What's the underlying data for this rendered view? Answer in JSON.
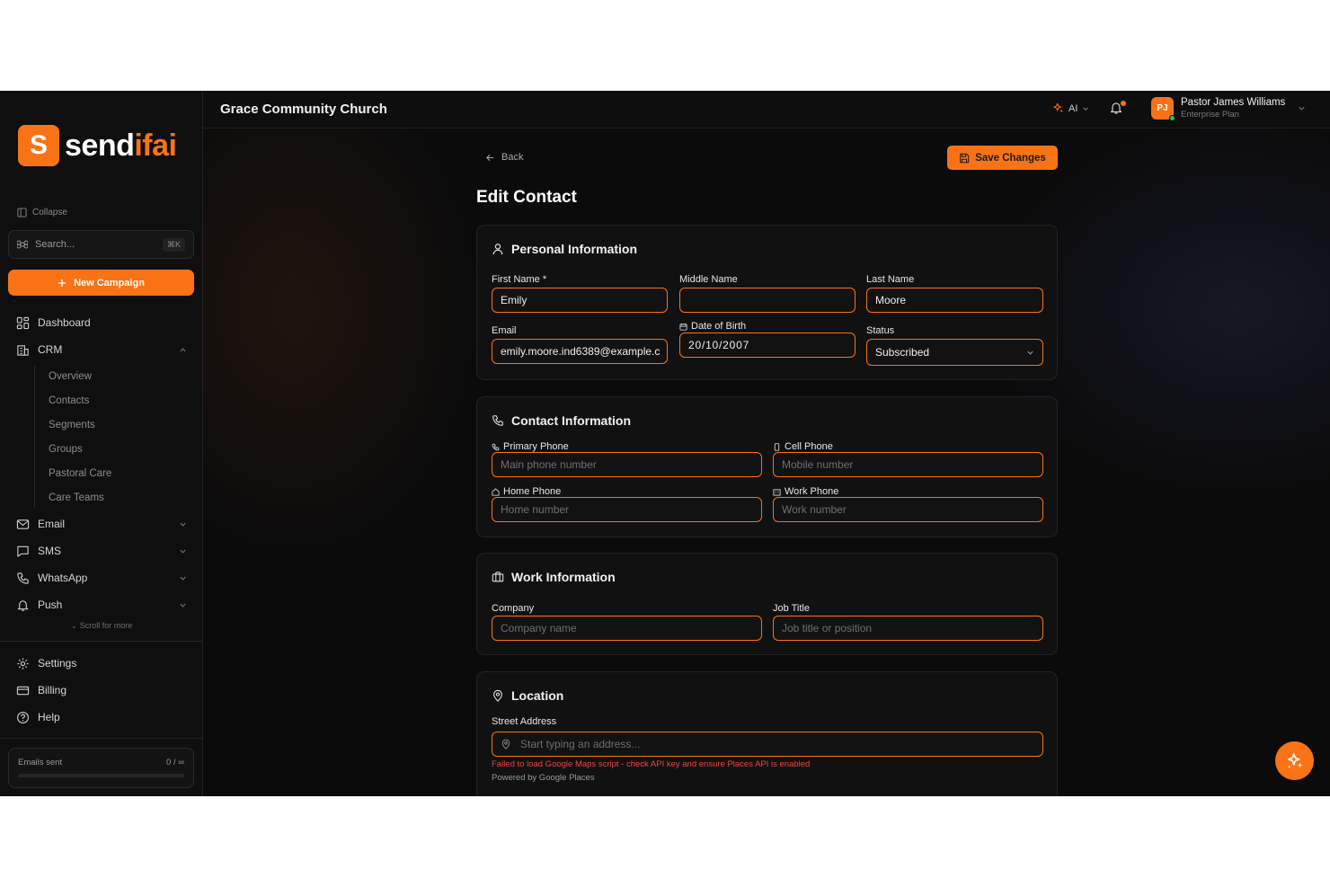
{
  "brand": {
    "logo_letter": "S",
    "name_part1": "send",
    "name_part2": "ifai",
    "accent": "#f97316"
  },
  "sidebar": {
    "collapse_label": "Collapse",
    "search_placeholder": "Search...",
    "search_shortcut": "⌘K",
    "new_campaign_label": "New Campaign",
    "nav": [
      {
        "label": "Dashboard"
      },
      {
        "label": "CRM"
      },
      {
        "label": "Email"
      },
      {
        "label": "SMS"
      },
      {
        "label": "WhatsApp"
      },
      {
        "label": "Push"
      }
    ],
    "crm_sub": [
      "Overview",
      "Contacts",
      "Segments",
      "Groups",
      "Pastoral Care",
      "Care Teams"
    ],
    "scroll_more": "Scroll for more",
    "bottom": [
      {
        "label": "Settings"
      },
      {
        "label": "Billing"
      },
      {
        "label": "Help"
      }
    ],
    "emails_sent": {
      "label": "Emails sent",
      "value": "0 / ∞",
      "progress": 0
    }
  },
  "header": {
    "org_name": "Grace Community Church",
    "ai_label": "AI",
    "user": {
      "initials": "PJ",
      "name": "Pastor James Williams",
      "plan": "Enterprise Plan"
    }
  },
  "page": {
    "back_label": "Back",
    "save_label": "Save Changes",
    "title": "Edit Contact"
  },
  "personal": {
    "title": "Personal Information",
    "first_name_label": "First Name *",
    "first_name": "Emily",
    "middle_name_label": "Middle Name",
    "middle_name": "",
    "last_name_label": "Last Name",
    "last_name": "Moore",
    "email_label": "Email",
    "email": "emily.moore.ind6389@example.c",
    "dob_label": "Date of Birth",
    "dob": "20/10/2007",
    "status_label": "Status",
    "status": "Subscribed"
  },
  "contact": {
    "title": "Contact Information",
    "primary_label": "Primary Phone",
    "primary_placeholder": "Main phone number",
    "cell_label": "Cell Phone",
    "cell_placeholder": "Mobile number",
    "home_label": "Home Phone",
    "home_placeholder": "Home number",
    "work_label": "Work Phone",
    "work_placeholder": "Work number"
  },
  "work": {
    "title": "Work Information",
    "company_label": "Company",
    "company_placeholder": "Company name",
    "job_label": "Job Title",
    "job_placeholder": "Job title or position"
  },
  "location": {
    "title": "Location",
    "street_label": "Street Address",
    "street_placeholder": "Start typing an address...",
    "error": "Failed to load Google Maps script - check API key and ensure Places API is enabled",
    "powered": "Powered by Google Places"
  }
}
